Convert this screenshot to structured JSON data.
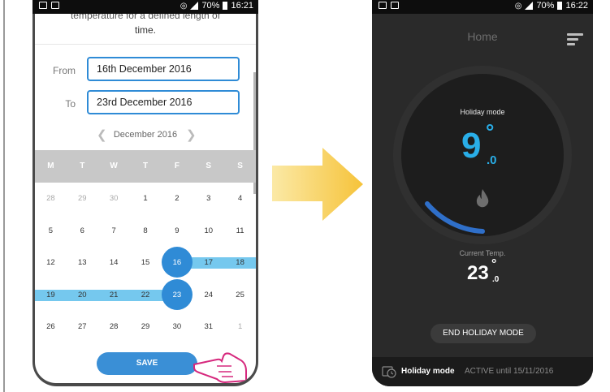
{
  "left_phone": {
    "status": {
      "battery": "70%",
      "time": "16:21"
    },
    "intro": {
      "line1": "temperature for a defined length of",
      "line2": "time."
    },
    "from": {
      "label": "From",
      "value": "16th December 2016"
    },
    "to": {
      "label": "To",
      "value": "23rd December 2016"
    },
    "calendar": {
      "month": "December 2016",
      "weekdays": [
        "M",
        "T",
        "W",
        "T",
        "F",
        "S",
        "S"
      ],
      "rows": [
        [
          "28",
          "29",
          "30",
          "1",
          "2",
          "3",
          "4"
        ],
        [
          "5",
          "6",
          "7",
          "8",
          "9",
          "10",
          "11"
        ],
        [
          "12",
          "13",
          "14",
          "15",
          "16",
          "17",
          "18"
        ],
        [
          "19",
          "20",
          "21",
          "22",
          "23",
          "24",
          "25"
        ],
        [
          "26",
          "27",
          "28",
          "29",
          "30",
          "31",
          "1"
        ]
      ]
    },
    "save_label": "SAVE"
  },
  "right_phone": {
    "status": {
      "battery": "70%",
      "time": "16:22"
    },
    "title": "Home",
    "mode_label": "Holiday mode",
    "setpoint": {
      "whole": "9",
      "degree": "°",
      "decimal": ".0"
    },
    "current_label": "Current Temp.",
    "current_temp": {
      "whole": "23",
      "degree": "°",
      "decimal": ".0"
    },
    "end_button": "END HOLIDAY MODE",
    "footer": {
      "mode": "Holiday mode",
      "status": "ACTIVE until 15/11/2016"
    }
  },
  "colors": {
    "accent_blue": "#2f8bd6",
    "range_band": "#75c8ee",
    "setpoint_blue": "#29aee8",
    "arrow_yellow": "#f6c33a"
  }
}
